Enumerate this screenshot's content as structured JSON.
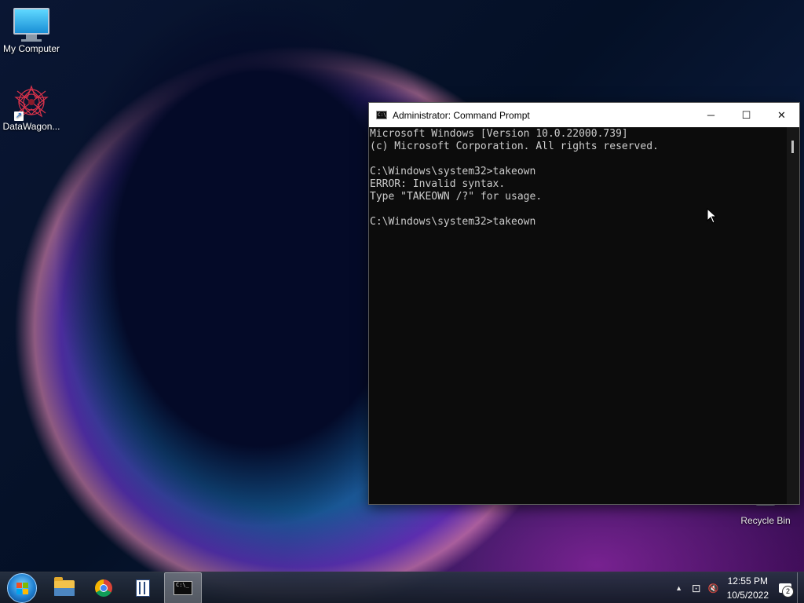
{
  "desktop": {
    "icons": [
      {
        "label": "My Computer"
      },
      {
        "label": "DataWagon..."
      },
      {
        "label": "Recycle Bin"
      }
    ]
  },
  "cmd_window": {
    "title": "Administrator: Command Prompt",
    "title_icon_text": "C:\\_",
    "minimize_glyph": "─",
    "maximize_glyph": "☐",
    "close_glyph": "✕",
    "lines": [
      "Microsoft Windows [Version 10.0.22000.739]",
      "(c) Microsoft Corporation. All rights reserved.",
      "",
      "C:\\Windows\\system32>takeown",
      "ERROR: Invalid syntax.",
      "Type \"TAKEOWN /?\" for usage.",
      "",
      "C:\\Windows\\system32>takeown"
    ]
  },
  "taskbar": {
    "pinned": [
      "Start",
      "File Explorer",
      "Google Chrome",
      "Library",
      "Command Prompt"
    ],
    "active_app": "Command Prompt",
    "tray": {
      "overflow_glyph": "▲",
      "network_glyph": "⊡",
      "volume_glyph": "🔇",
      "time": "12:55 PM",
      "date": "10/5/2022",
      "notification_count": "2"
    }
  },
  "colors": {
    "console_bg": "#0c0c0c",
    "console_fg": "#cccccc",
    "titlebar_bg": "#ffffff"
  }
}
